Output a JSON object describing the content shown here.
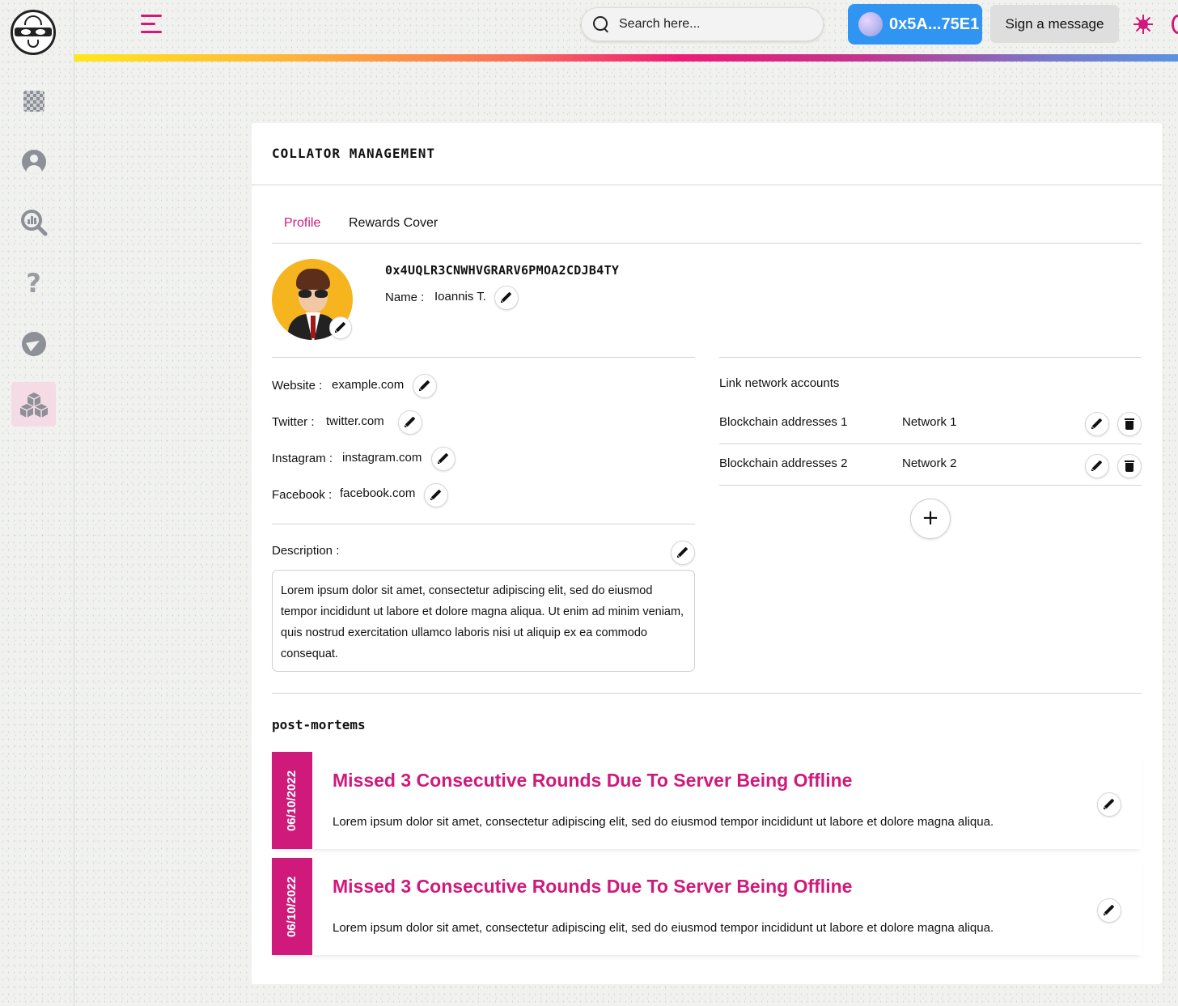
{
  "topbar": {
    "search_placeholder": "Search here...",
    "wallet_label": "0x5A...75E1",
    "sign_button": "Sign a message"
  },
  "sidebar": {
    "items": [
      {
        "icon": "dashboard-icon"
      },
      {
        "icon": "user-icon"
      },
      {
        "icon": "analytics-icon"
      },
      {
        "icon": "help-icon"
      },
      {
        "icon": "telegram-icon"
      },
      {
        "icon": "blocks-icon",
        "active": true
      }
    ]
  },
  "card": {
    "title": "COLLATOR MANAGEMENT",
    "tabs": [
      {
        "label": "Profile",
        "active": true
      },
      {
        "label": "Rewards Cover",
        "active": false
      }
    ],
    "profile": {
      "address": "0x4UQLR3CNWHVGRARV6PMOA2CDJB4TY",
      "name_label": "Name :",
      "name_value": "Ioannis T."
    },
    "socials": [
      {
        "label": "Website :",
        "value": "example.com"
      },
      {
        "label": "Twitter :",
        "value": "twitter.com"
      },
      {
        "label": "Instagram :",
        "value": "instagram.com"
      },
      {
        "label": "Facebook :",
        "value": "facebook.com"
      }
    ],
    "description": {
      "label": "Description :",
      "text": "Lorem ipsum dolor sit amet, consectetur adipiscing elit, sed do eiusmod tempor incididunt ut labore et dolore magna aliqua. Ut enim ad minim veniam, quis nostrud exercitation ullamco laboris nisi ut aliquip ex ea commodo consequat."
    },
    "link_networks": {
      "title": "Link network accounts",
      "rows": [
        {
          "address": "Blockchain addresses 1",
          "network": "Network 1"
        },
        {
          "address": "Blockchain addresses 2",
          "network": "Network 2"
        }
      ],
      "add_label": "+"
    },
    "post_mortems": {
      "title": "post-mortems",
      "items": [
        {
          "date": "06/10/2022",
          "title": "Missed 3 Consecutive Rounds Due To Server Being Offline",
          "body": "Lorem ipsum dolor sit amet, consectetur adipiscing elit, sed do eiusmod tempor incididunt ut labore et dolore magna aliqua."
        },
        {
          "date": "06/10/2022",
          "title": "Missed 3 Consecutive Rounds Due To Server Being Offline",
          "body": "Lorem ipsum dolor sit amet, consectetur adipiscing elit, sed do eiusmod tempor incididunt ut labore et dolore magna aliqua."
        }
      ]
    }
  },
  "colors": {
    "accent": "#cf1a7c",
    "wallet_blue": "#2f94f2",
    "active_nav_bg": "#f5dbe6"
  }
}
